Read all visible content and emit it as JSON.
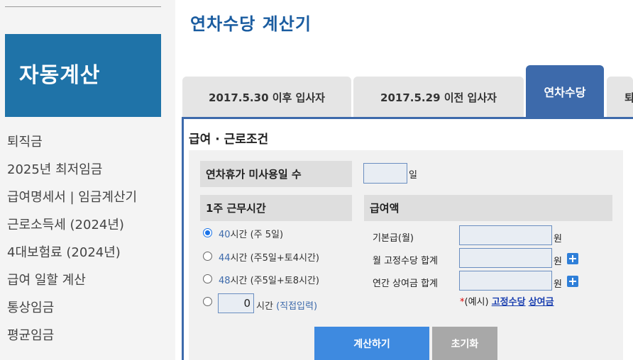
{
  "sidebar": {
    "banner": "자동계산",
    "items": [
      {
        "label": "퇴직금"
      },
      {
        "label": "2025년 최저임금"
      },
      {
        "label": "급여명세서 | 임금계산기"
      },
      {
        "label": "근로소득세 (2024년)"
      },
      {
        "label": "4대보험료 (2024년)"
      },
      {
        "label": "급여 일할 계산"
      },
      {
        "label": "통상임금"
      },
      {
        "label": "평균임금"
      }
    ]
  },
  "page_title": "연차수당 계산기",
  "tabs": [
    {
      "label": "2017.5.30 이후 입사자",
      "active": false
    },
    {
      "label": "2017.5.29 이전 입사자",
      "active": false
    },
    {
      "label": "연차수당",
      "active": true
    },
    {
      "label": "퇴",
      "active": false
    }
  ],
  "section_title": "급여 · 근로조건",
  "unused_leave": {
    "label": "연차휴가 미사용일 수",
    "value": "",
    "unit": "일"
  },
  "weekly_hours": {
    "label": "1주 근무시간",
    "options": [
      {
        "hours": "40",
        "text": "시간 (주 5일)",
        "checked": true
      },
      {
        "hours": "44",
        "text": "시간 (주5일+토4시간)",
        "checked": false
      },
      {
        "hours": "48",
        "text": "시간 (주5일+토8시간)",
        "checked": false
      }
    ],
    "direct": {
      "value": "0",
      "unit": "시간",
      "note": "(직접입력)"
    }
  },
  "pay": {
    "label": "급여액",
    "rows": [
      {
        "label": "기본급(월)",
        "value": "",
        "unit": "원",
        "plus": false
      },
      {
        "label": "월 고정수당 합계",
        "value": "",
        "unit": "원",
        "plus": true
      },
      {
        "label": "연간 상여금 합계",
        "value": "",
        "unit": "원",
        "plus": true
      }
    ],
    "note_prefix": "*",
    "note_text": "(예시) ",
    "note_link1": "고정수당",
    "note_link2": "상여금"
  },
  "buttons": {
    "calculate": "계산하기",
    "reset": "초기화"
  },
  "colors": {
    "brand": "#1f73a8",
    "tab_active": "#3d6aab",
    "calc_button": "#3e8ae0",
    "reset_button": "#a8a8a8",
    "plus_icon": "#2f7fd8"
  }
}
